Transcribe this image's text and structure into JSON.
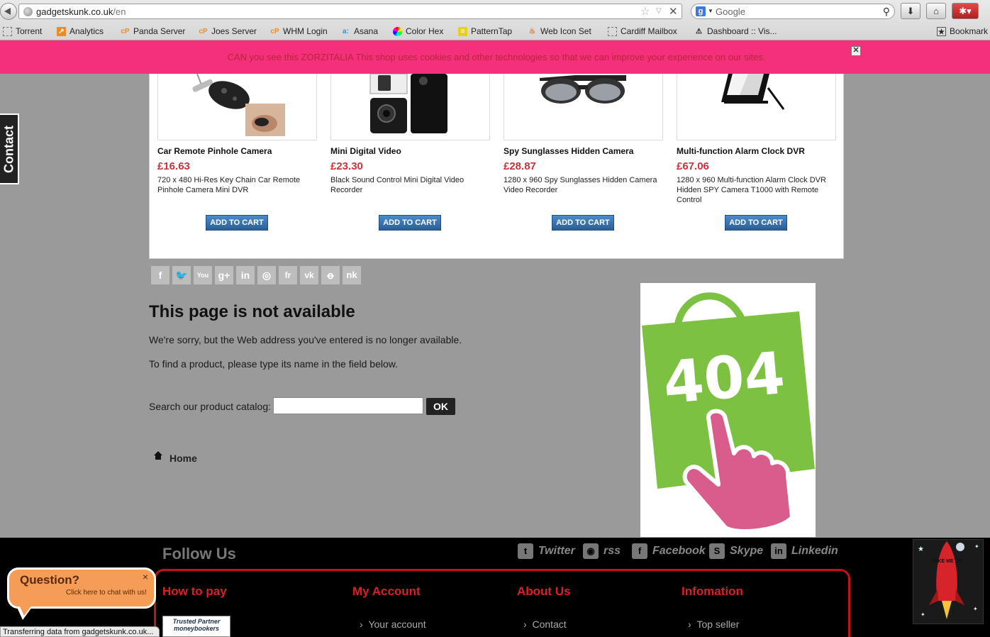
{
  "browser": {
    "url_host": "gadgetskunk.co.uk",
    "url_path": "/en",
    "search_placeholder": "Google",
    "bookmarks": [
      {
        "label": "Torrent"
      },
      {
        "label": "Analytics"
      },
      {
        "label": "Panda Server"
      },
      {
        "label": "Joes Server"
      },
      {
        "label": "WHM Login"
      },
      {
        "label": "Asana"
      },
      {
        "label": "Color Hex"
      },
      {
        "label": "PatternTap"
      },
      {
        "label": "Web Icon Set"
      },
      {
        "label": "Cardiff Mailbox"
      },
      {
        "label": "Dashboard :: Vis..."
      },
      {
        "label": "Bookmark"
      }
    ],
    "status_text": "Transferring data from gadgetskunk.co.uk..."
  },
  "cookie_banner": {
    "text": "CAN you see this ZORZITALIA This shop uses cookies and other technologies so that we can improve your experience on our sites.",
    "close": "✕"
  },
  "contact_tab": "Contact",
  "products": [
    {
      "name": "Car Remote Pinhole Camera",
      "price": "£16.63",
      "desc": "720 x 480 Hi-Res Key Chain Car Remote Pinhole Camera Mini DVR",
      "button": "ADD TO CART"
    },
    {
      "name": "Mini Digital Video",
      "price": "£23.30",
      "desc": "Black Sound Control Mini Digital Video Recorder",
      "button": "ADD TO CART"
    },
    {
      "name": "Spy Sunglasses Hidden Camera",
      "price": "£28.87",
      "desc": "1280 x 960 Spy Sunglasses Hidden Camera Video Recorder",
      "button": "ADD TO CART"
    },
    {
      "name": "Multi-function Alarm Clock DVR",
      "price": "£67.06",
      "desc": "1280 x 960 Multi-function Alarm Clock DVR Hidden SPY Camera T1000 with Remote Control",
      "button": "ADD TO CART"
    }
  ],
  "share_icons": [
    "f",
    "t",
    "yt",
    "g+",
    "in",
    "ig",
    "fr",
    "vk",
    "ok",
    "nk"
  ],
  "error_page": {
    "title": "This page is not available",
    "message1": "We're sorry, but the Web address you've entered is no longer available.",
    "message2": "To find a product, please type its name in the field below.",
    "search_label": "Search our product catalog:",
    "search_value": "",
    "ok_button": "OK",
    "home_link": "Home",
    "image_number": "404"
  },
  "footer": {
    "follow_us": "Follow Us",
    "social": [
      {
        "label": "Twitter",
        "icon": "twitter-icon"
      },
      {
        "label": "rss",
        "icon": "rss-icon"
      },
      {
        "label": "Facebook",
        "icon": "facebook-icon"
      },
      {
        "label": "Skype",
        "icon": "skype-icon"
      },
      {
        "label": "Linkedin",
        "icon": "linkedin-icon"
      }
    ],
    "columns": [
      {
        "heading": "How to pay",
        "link": ""
      },
      {
        "heading": "My Account",
        "link": "Your account"
      },
      {
        "heading": "About Us",
        "link": "Contact"
      },
      {
        "heading": "Infomation",
        "link": "Top seller"
      }
    ],
    "moneybookers": "Trusted Partner moneybookers",
    "rocket_label": "TAKE ME UP"
  },
  "chat": {
    "title": "Question?",
    "subtitle": "Click here to chat with us!",
    "close": "×"
  },
  "colors": {
    "banner": "#f5307a",
    "price": "#c8323a",
    "button": "#2a5f98",
    "bag_green": "#7cc142",
    "hand_pink": "#d95d8c",
    "footer_red": "#c01317",
    "chat_orange": "#f59d57"
  }
}
